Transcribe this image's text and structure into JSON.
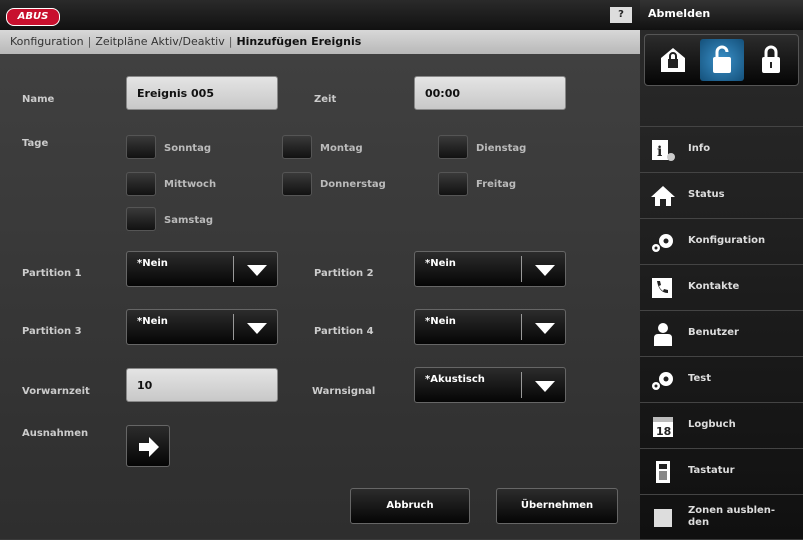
{
  "header": {
    "logo_text": "ABUS",
    "help_label": "?",
    "logout_label": "Abmelden"
  },
  "breadcrumb": {
    "item1": "Konfiguration",
    "item2": "Zeitpläne Aktiv/Deaktiv",
    "current": "Hinzufügen Ereignis",
    "separator": "|"
  },
  "form": {
    "name_label": "Name",
    "name_value": "Ereignis 005",
    "zeit_label": "Zeit",
    "zeit_value": "00:00",
    "tage_label": "Tage",
    "days": [
      "Sonntag",
      "Montag",
      "Dienstag",
      "Mittwoch",
      "Donnerstag",
      "Freitag",
      "Samstag"
    ],
    "partition1_label": "Partition 1",
    "partition1_value": "*Nein",
    "partition2_label": "Partition 2",
    "partition2_value": "*Nein",
    "partition3_label": "Partition 3",
    "partition3_value": "*Nein",
    "partition4_label": "Partition 4",
    "partition4_value": "*Nein",
    "vorwarnzeit_label": "Vorwarnzeit",
    "vorwarnzeit_value": "10",
    "warnsignal_label": "Warnsignal",
    "warnsignal_value": "*Akustisch",
    "ausnahmen_label": "Ausnahmen",
    "cancel_label": "Abbruch",
    "apply_label": "Übernehmen"
  },
  "sidebar": {
    "items": [
      {
        "label": "Info",
        "icon": "info-icon"
      },
      {
        "label": "Status",
        "icon": "home-icon"
      },
      {
        "label": "Konfiguration",
        "icon": "gear-icon"
      },
      {
        "label": "Kontakte",
        "icon": "phone-icon"
      },
      {
        "label": "Benutzer",
        "icon": "user-icon"
      },
      {
        "label": "Test",
        "icon": "gear-icon"
      },
      {
        "label": "Logbuch",
        "icon": "calendar-icon"
      },
      {
        "label": "Tastatur",
        "icon": "keypad-icon"
      },
      {
        "label": "Zonen ausblen-",
        "label2": "den",
        "icon": "zone-icon"
      }
    ],
    "calendar_day": "18"
  },
  "colors": {
    "accent": "#c8102e",
    "active_lock": "#3a90c8"
  }
}
